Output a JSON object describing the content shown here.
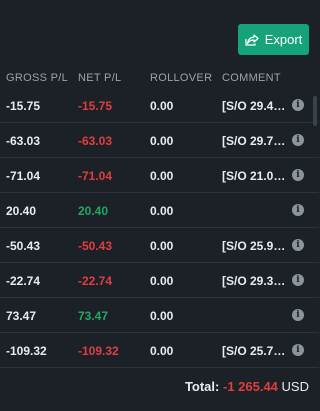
{
  "toolbar": {
    "export_label": "Export"
  },
  "table": {
    "columns": [
      "GROSS P/L",
      "NET P/L",
      "ROLLOVER",
      "COMMENT"
    ],
    "rows": [
      {
        "gross": "-15.75",
        "net": "-15.75",
        "rollover": "0.00",
        "comment": "[S/O 29.4…",
        "net_sign": "neg"
      },
      {
        "gross": "-63.03",
        "net": "-63.03",
        "rollover": "0.00",
        "comment": "[S/O 29.7…",
        "net_sign": "neg"
      },
      {
        "gross": "-71.04",
        "net": "-71.04",
        "rollover": "0.00",
        "comment": "[S/O 21.0…",
        "net_sign": "neg"
      },
      {
        "gross": "20.40",
        "net": "20.40",
        "rollover": "0.00",
        "comment": "",
        "net_sign": "pos"
      },
      {
        "gross": "-50.43",
        "net": "-50.43",
        "rollover": "0.00",
        "comment": "[S/O 25.9…",
        "net_sign": "neg"
      },
      {
        "gross": "-22.74",
        "net": "-22.74",
        "rollover": "0.00",
        "comment": "[S/O 29.3…",
        "net_sign": "neg"
      },
      {
        "gross": "73.47",
        "net": "73.47",
        "rollover": "0.00",
        "comment": "",
        "net_sign": "pos"
      },
      {
        "gross": "-109.32",
        "net": "-109.32",
        "rollover": "0.00",
        "comment": "[S/O 25.7…",
        "net_sign": "neg"
      }
    ]
  },
  "footer": {
    "total_label": "Total:",
    "total_value": "-1 265.44",
    "currency": "USD"
  },
  "colors": {
    "background": "#1b2127",
    "accent": "#17a37a",
    "negative": "#e03e3e",
    "positive": "#22a765"
  },
  "icons": {
    "export": "export-icon",
    "info": "info-icon"
  }
}
